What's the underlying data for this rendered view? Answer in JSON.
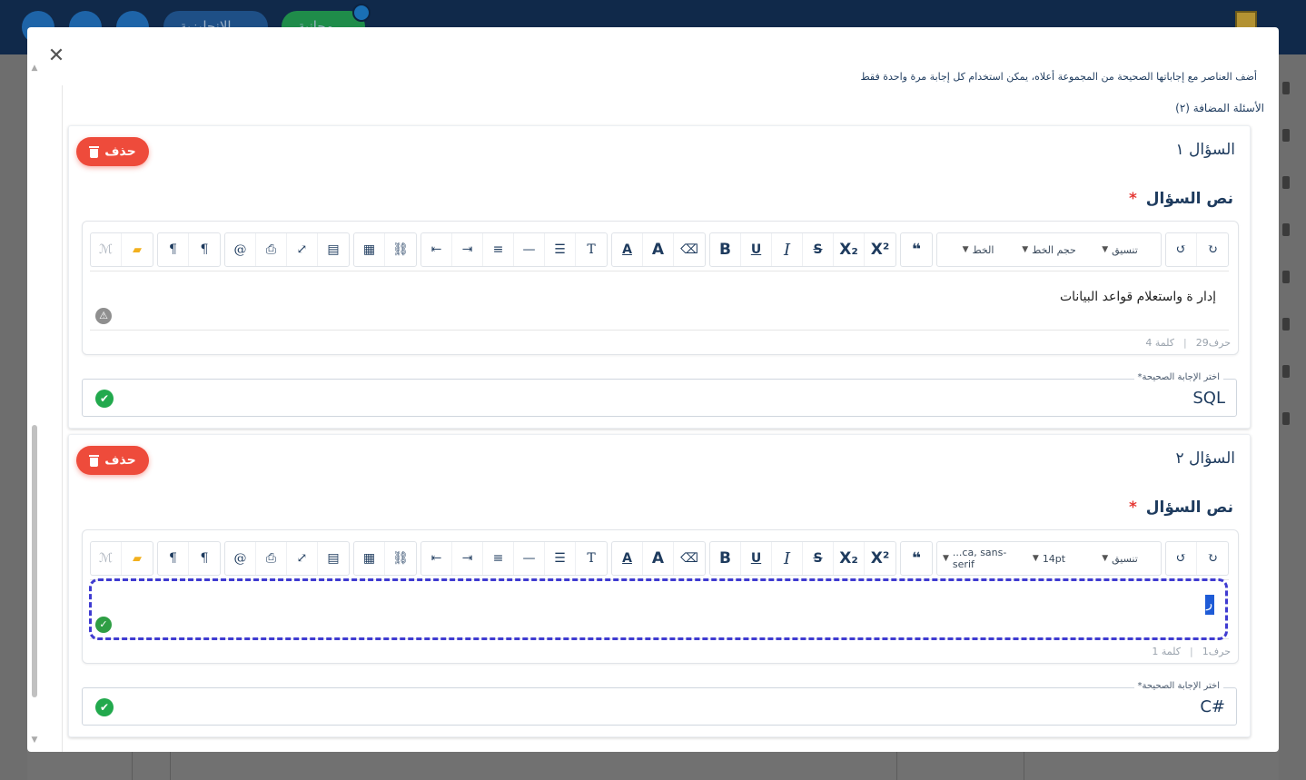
{
  "background": {
    "lang_pill": "الإنجليزية",
    "free_pill": "مجانية"
  },
  "modal": {
    "close_label": "✕",
    "instruction": "أضف العناصر مع إجاباتها الصحيحة من المجموعة أعلاه، يمكن استخدام كل إجابة مرة واحدة فقط",
    "added_title": "الأسئلة المضافة (٢)",
    "questions": [
      {
        "title": "السؤال ١",
        "delete_label": "حذف",
        "text_label": "نص السؤال",
        "required_mark": "*",
        "editor": {
          "toolbar_selects": {
            "style": "تنسيق",
            "size": "حجم الخط",
            "font": "الخط"
          },
          "content": "إدار ة واستعلام قواعد البيانات",
          "chars": "حرف29",
          "words": "كلمة 4"
        },
        "answer": {
          "legend": "اختر الإجابة الصحيحة*",
          "value": "SQL"
        }
      },
      {
        "title": "السؤال ٢",
        "delete_label": "حذف",
        "text_label": "نص السؤال",
        "required_mark": "*",
        "editor": {
          "toolbar_selects": {
            "style": "تنسيق",
            "size": "14pt",
            "font": "...ca, sans-serif"
          },
          "content": "ر",
          "chars": "حرف1",
          "words": "كلمة 1"
        },
        "answer": {
          "legend": "اختر الإجابة الصحيحة*",
          "value": "C#"
        }
      }
    ]
  },
  "colors": {
    "brand_navy": "#10294a",
    "delete_red": "#ee4b3b",
    "success_green": "#22a94d",
    "focus_blue": "#3f3bd1"
  }
}
